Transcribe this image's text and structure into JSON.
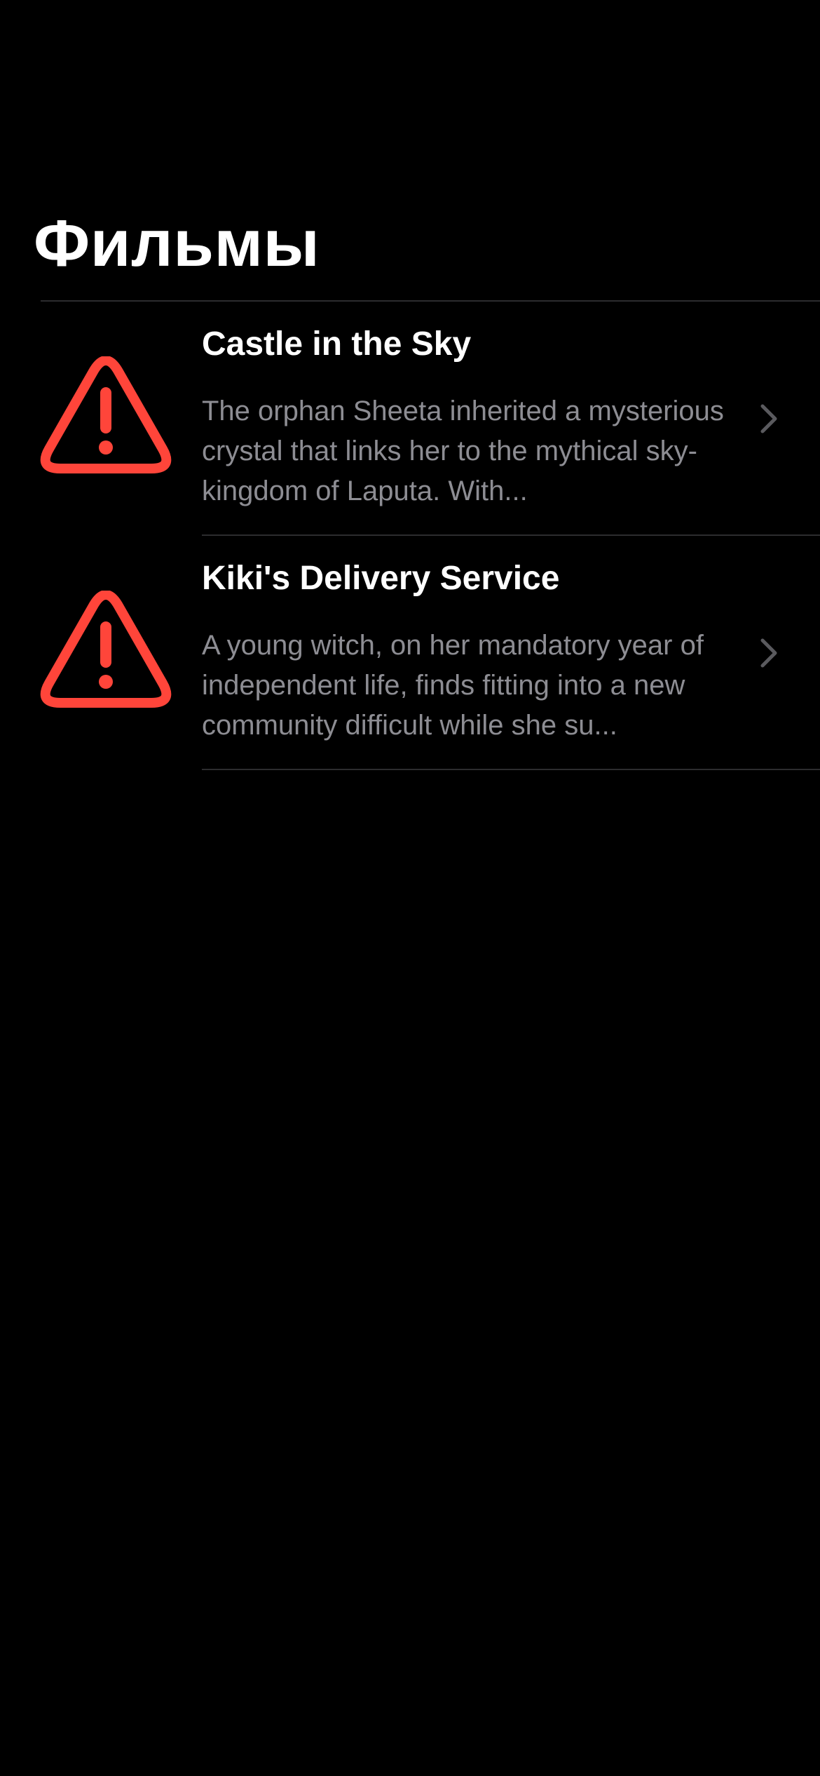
{
  "nav": {
    "title": "Фильмы"
  },
  "films": [
    {
      "title": "Castle in the Sky",
      "description": "The orphan Sheeta inherited a mysterious crystal that links her to the mythical sky-kingdom of Laputa. With...",
      "icon": "exclamation-triangle-icon",
      "accessory": "chevron-right-icon"
    },
    {
      "title": "Kiki's Delivery Service",
      "description": "A young witch, on her mandatory year of independent life, finds fitting into a new community difficult while she su...",
      "icon": "exclamation-triangle-icon",
      "accessory": "chevron-right-icon"
    }
  ],
  "colors": {
    "background": "#000000",
    "title": "#ffffff",
    "secondary_text": "#8d8d93",
    "warning_icon": "#ff453a",
    "chevron": "#5a5a5e",
    "separator": "#2c2c2e"
  }
}
